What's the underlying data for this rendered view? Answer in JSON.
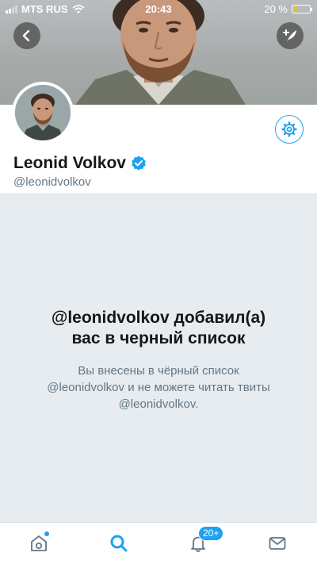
{
  "status_bar": {
    "carrier": "MTS RUS",
    "time": "20:43",
    "battery_percent": "20 %",
    "battery_level": 0.2,
    "signal_bars": 2,
    "colors": {
      "battery": "#f5c400"
    }
  },
  "header": {
    "back_icon": "chevron-left-icon",
    "compose_icon": "feather-plus-icon"
  },
  "profile": {
    "display_name": "Leonid Volkov",
    "handle": "@leonidvolkov",
    "verified": true,
    "settings_icon": "gear-icon"
  },
  "blocked": {
    "title_line1": "@leonidvolkov добавил(а)",
    "title_line2": "вас в черный список",
    "desc_line1": "Вы внесены в чёрный список",
    "desc_line2": "@leonidvolkov и не можете читать твиты",
    "desc_line3": "@leonidvolkov."
  },
  "tab_bar": {
    "items": [
      {
        "icon": "home-icon",
        "has_dot": true
      },
      {
        "icon": "search-icon",
        "active": true
      },
      {
        "icon": "bell-icon",
        "badge": "20+"
      },
      {
        "icon": "mail-icon"
      }
    ]
  },
  "colors": {
    "accent": "#1da1f2",
    "background": "#e6ecf0",
    "text_primary": "#14171a",
    "text_secondary": "#657786"
  }
}
